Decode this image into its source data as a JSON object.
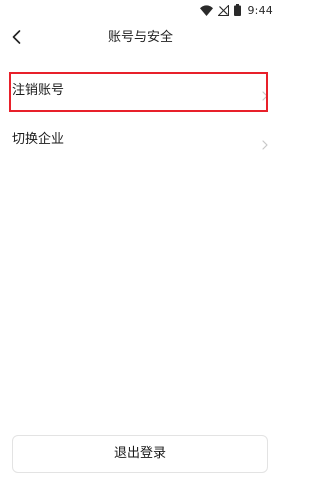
{
  "status_bar": {
    "time": "9:44",
    "icons": [
      "wifi-icon",
      "no-signal-icon",
      "battery-icon"
    ]
  },
  "header": {
    "title": "账号与安全",
    "back_icon": "chevron-left-icon"
  },
  "menu": {
    "items": [
      {
        "label": "注销账号",
        "icon": "chevron-right-icon",
        "highlighted": true
      },
      {
        "label": "切换企业",
        "icon": "chevron-right-icon",
        "highlighted": false
      }
    ]
  },
  "footer": {
    "logout_label": "退出登录"
  },
  "colors": {
    "highlight": "#e8202a",
    "chevron": "#c8c8c8",
    "button_border": "#e3e3e3",
    "text": "#1a1a1a"
  }
}
